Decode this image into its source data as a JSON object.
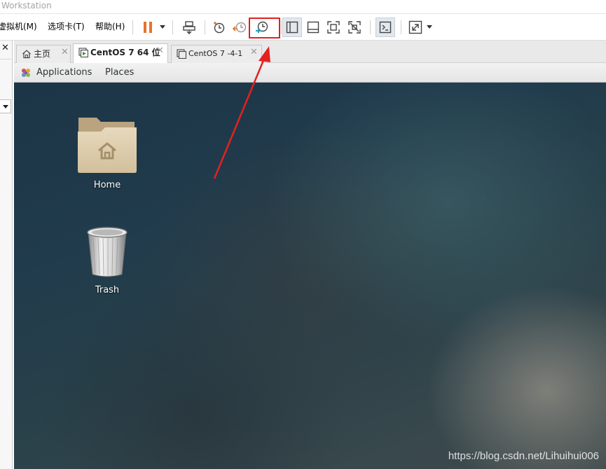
{
  "window": {
    "title": "Workstation"
  },
  "menu": [
    {
      "label": "虚拟机(M)"
    },
    {
      "label": "选项卡(T)"
    },
    {
      "label": "帮助(H)"
    }
  ],
  "toolbar": {
    "icons": [
      "pause-icon",
      "send-ctrl-alt-del-icon",
      "snapshot-take-icon",
      "snapshot-revert-icon",
      "snapshot-manager-icon",
      "library-view-icon",
      "thumbnail-bar-icon",
      "fullscreen-icon",
      "unity-icon",
      "console-icon",
      "stretch-icon"
    ],
    "highlight_color": "#e02020"
  },
  "tabs": [
    {
      "label": "主页",
      "icon": "home-icon",
      "active": false
    },
    {
      "label": "CentOS 7 64 位",
      "icon": "vm-running-icon",
      "active": true
    },
    {
      "label": "CentOS 7 -4-1",
      "icon": "vm-icon",
      "active": false
    }
  ],
  "gnome_panel": {
    "applications": "Applications",
    "places": "Places"
  },
  "desktop": {
    "icons": [
      {
        "label": "Home",
        "icon": "home-folder-icon"
      },
      {
        "label": "Trash",
        "icon": "trash-icon"
      }
    ],
    "watermark": "https://blog.csdn.net/Lihuihui006"
  },
  "colors": {
    "annotation_red": "#e02020",
    "accent_orange": "#e8732a",
    "accent_teal": "#2a9fb4"
  }
}
